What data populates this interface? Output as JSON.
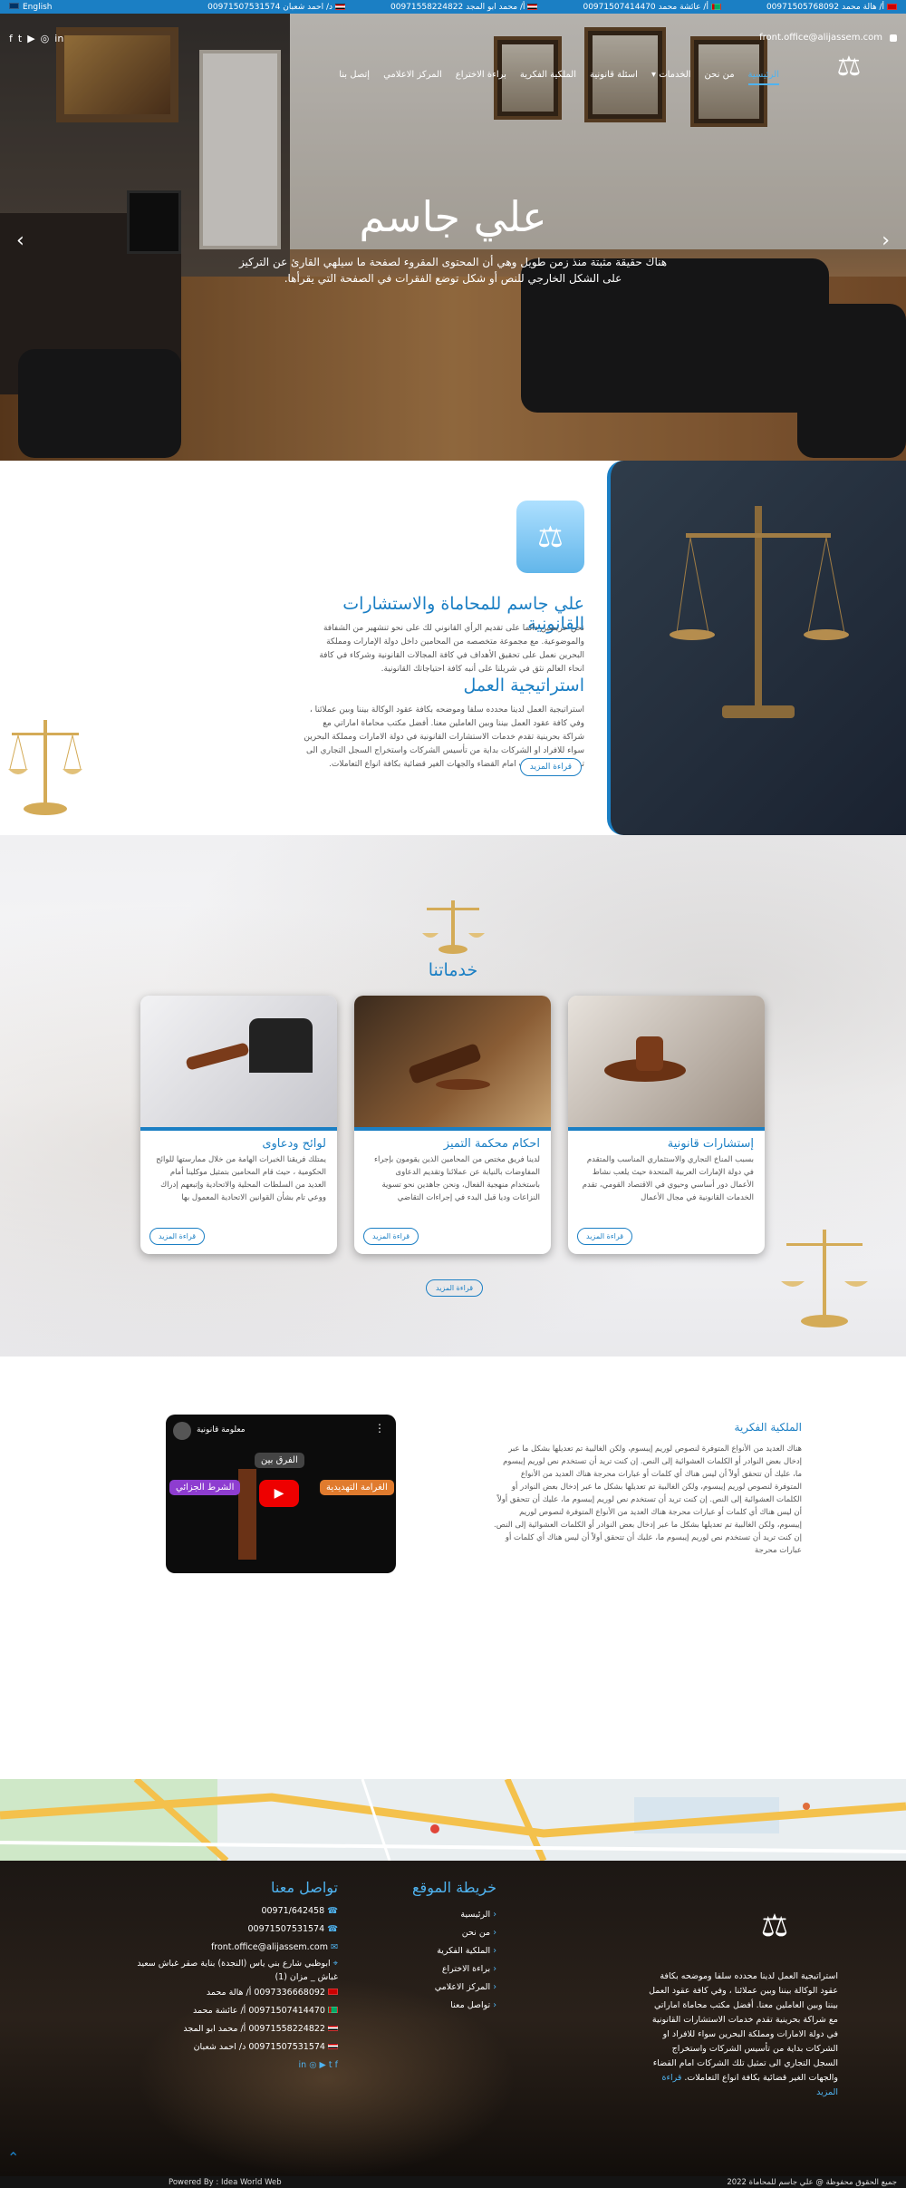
{
  "topbar": {
    "contacts": [
      {
        "name": "أ/ هالة محمد",
        "phone": "00971505768092"
      },
      {
        "name": "أ/ عائشة محمد",
        "phone": "00971507414470"
      },
      {
        "name": "أ/ محمد ابو المجد",
        "phone": "00971558224822"
      },
      {
        "name": "د/ احمد شعبان",
        "phone": "00971507531574"
      }
    ],
    "email": "front.office@alijassem.com",
    "lang": "English"
  },
  "nav": {
    "items": [
      "الرئيسية",
      "من نحن",
      "الخدمات",
      "اسئلة قانونية",
      "الملكية الفكرية",
      "براءة الاختراع",
      "المركز الاعلامي",
      "إتصل بنا"
    ],
    "active_index": 0
  },
  "hero": {
    "title": "علي جاسم",
    "lead": "هناك حقيقة مثبتة منذ زمن طويل وهي أن المحتوى المقروء لصفحة ما سيلهي القارئ عن التركيز على الشكل الخارجي للنص أو شكل توضع الفقرات في الصفحة التي يقرأها."
  },
  "about": {
    "title": "علي جاسم للمحاماة والاستشارات القانونية",
    "intro": "نحن حريصين دائما على تقديم الرأي القانوني لك على نحو تنشهير من الشفافة والموضوعية. مع مجموعة متخصصه من المحامين داخل دولة الإمارات ومملكة البحرين نعمل على تحقيق الأهداف في كافة المجالات القانونية وشركاء في كافة انحاء العالم نثق في شريلنا على أنبه كافة احتياجاتك القانونية.",
    "strategy_title": "استراتيجية العمل",
    "strategy": "استراتيجية العمل لدينا محدده سلفا وموضحه بكافة عقود الوكالة بيننا وبين عملائنا ، وفي كافة عقود العمل بيننا وبين العاملين معنا. أفضل مكتب محاماة اماراتي مع شراكة بحرينية تقدم خدمات الاستشارات القانونية في دولة الامارات ومملكة البحرين سواء للافراد او الشركات بداية من تأسيس الشركات واستخراج السجل التجاري الى تمثيل تلك الشركات امام القضاء والجهات الغير قضائية بكافة انواع التعاملات.",
    "more": "قراءة المزيد"
  },
  "services": {
    "title": "خدماتنا",
    "cards": [
      {
        "title": "إستشارات قانونية",
        "text": "بسبب المناخ التجاري والاستثماري المناسب والمتقدم في دولة الإمارات العربية المتحدة حيث يلعب نشاط الأعمال دور أساسي وحيوي في الاقتصاد القومي، تقدم الخدمات القانونية في مجال الأعمال",
        "btn": "قراءة المزيد"
      },
      {
        "title": "احكام محكمة التميز",
        "text": "لدينا فريق مختص من المحامين الذين يقومون بإجراء المفاوضات بالنيابة عن عملائنا وتقديم الدعاوى باستخدام منهجية الفعال، ونحن جاهدين نحو تسوية النزاعات وديا قبل البدء في إجراءات التقاضي",
        "btn": "قراءة المزيد"
      },
      {
        "title": "لوائح ودعاوى",
        "text": "يمتلك فريقنا الخبرات الهامة من خلال ممارستها للوائح الحكومية ، حيث قام المحامين بتمثيل موكلينا أمام العديد من السلطات المحلية والاتحادية وإتبعهم إدراك ووعي تام بشأن القوانين الاتحادية المعمول بها",
        "btn": "قراءة المزيد"
      }
    ],
    "more": "قراءة المزيد"
  },
  "video": {
    "channel": "معلومة قانونية",
    "tag1": "الفرق بين",
    "tag2": "الغرامة التهديدية",
    "tag3": "الشرط الجزائي"
  },
  "legal": {
    "title": "الملكية الفكرية",
    "text": "هناك العديد من الأنواع المتوفرة لنصوص لوريم إيبسوم، ولكن الغالبية تم تعديلها بشكل ما عبر إدخال بعض النوادر أو الكلمات العشوائية إلى النص. إن كنت تريد أن تستخدم نص لوريم إيبسوم ما، عليك أن تتحقق أولاً أن ليس هناك أي كلمات أو عبارات محرجة هناك العديد من الأنواع المتوفرة لنصوص لوريم إيبسوم، ولكن الغالبية تم تعديلها بشكل ما عبر إدخال بعض النوادر أو الكلمات العشوائية إلى النص. إن كنت تريد أن تستخدم نص لوريم إيبسوم ما، عليك أن تتحقق أولاً أن ليس هناك أي كلمات أو عبارات محرجة هناك العديد من الأنواع المتوفرة لنصوص لوريم إيبسوم، ولكن الغالبية تم تعديلها بشكل ما عبر إدخال بعض النوادر أو الكلمات العشوائية إلى النص. إن كنت تريد أن تستخدم نص لوريم إيبسوم ما، عليك أن تتحقق أولاً أن ليس هناك أي كلمات أو عبارات محرجة"
  },
  "footer": {
    "about": "استراتيجية العمل لدينا محدده سلفا وموضحه بكافة عقود الوكالة بيننا وبين عملائنا ، وفي كافة عقود العمل بيننا وبين العاملين معنا. أفضل مكتب محاماة اماراتي مع شراكة بحرينية تقدم خدمات الاستشارات القانونية في دولة الامارات ومملكة البحرين سواء للافراد او الشركات بداية من تأسيس الشركات واستخراج السجل التجاري الى تمثيل تلك الشركات امام القضاء والجهات الغير قضائية بكافة انواع التعاملات.",
    "about_more": "قراءة المزيد",
    "sitemap_title": "خريطة الموقع",
    "sitemap": [
      "الرئيسية",
      "من نحن",
      "الملكية الفكرية",
      "براءة الاختراع",
      "المركز الاعلامي",
      "تواصل معنا"
    ],
    "contact_title": "تواصل معنا",
    "contact": [
      "00971/642458",
      "00971507531574",
      "front.office@alijassem.com",
      "ابوظبي شارع بني ياس (النجدة) بناية صقر غباش سعيد غباش _ مزان (1)",
      "0097336668092 أ/ هالة محمد",
      "00971507414470 أ/ عائشة محمد",
      "00971558224822 أ/ محمد ابو المجد",
      "00971507531574 د/ احمد شعبان"
    ]
  },
  "bottom": {
    "copyright": "جميع الحقوق محفوظة @ علي جاسم للمحاماة 2022",
    "powered": "Powered By : Idea World Web"
  }
}
